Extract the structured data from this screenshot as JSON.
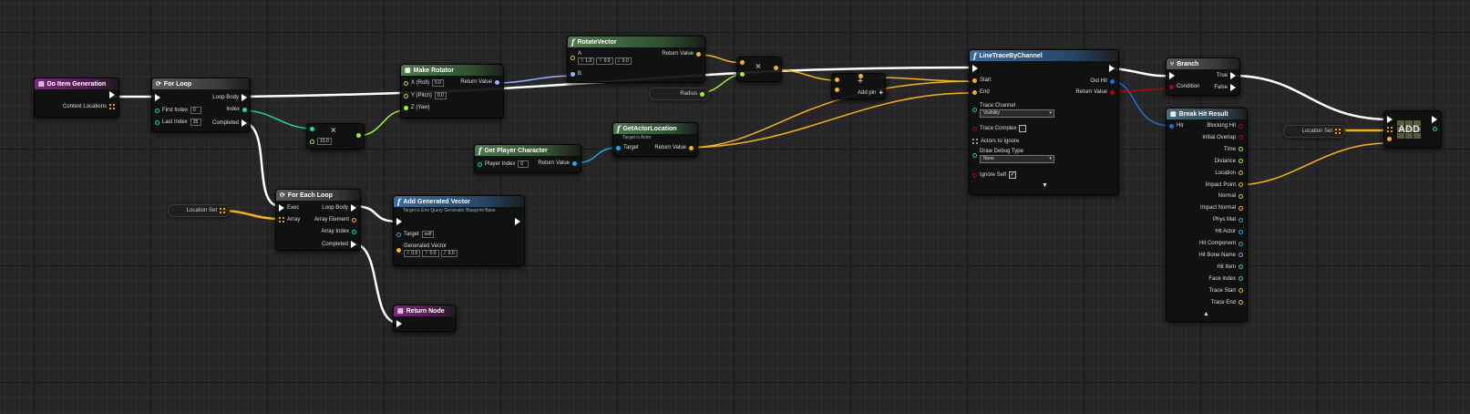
{
  "nodes": {
    "do_item_generation": {
      "title": "Do Item Generation",
      "contextual_locations": "Context Locations"
    },
    "for_loop": {
      "title": "For Loop",
      "first_index_label": "First Index",
      "first_index_value": "0",
      "last_index_label": "Last Index",
      "last_index_value": "35",
      "loop_body": "Loop Body",
      "index": "Index",
      "completed": "Completed"
    },
    "multiply": {
      "op": "×",
      "value": "10.0"
    },
    "make_rotator": {
      "title": "Make Rotator",
      "x_label": "X (Roll)",
      "x_value": "0.0",
      "y_label": "Y (Pitch)",
      "y_value": "0.0",
      "z_label": "Z (Yaw)",
      "return_value": "Return Value"
    },
    "rotate_vector": {
      "title": "RotateVector",
      "a_label": "A",
      "x": "1.0",
      "y": "0.0",
      "z": "0.0",
      "b_label": "B",
      "return_value": "Return Value"
    },
    "multiply2": {
      "op": "×"
    },
    "radius": {
      "label": "Radius"
    },
    "add_pin": {
      "op": "+",
      "label": "Add pin",
      "plus": "+"
    },
    "get_player_character": {
      "title": "Get Player Character",
      "player_index_label": "Player Index",
      "player_index_value": "0",
      "return_value": "Return Value"
    },
    "get_actor_location": {
      "title": "GetActorLocation",
      "subtitle": "Target is Actor",
      "target": "Target",
      "return_value": "Return Value"
    },
    "line_trace": {
      "title": "LineTraceByChannel",
      "start": "Start",
      "end": "End",
      "trace_channel_label": "Trace Channel",
      "trace_channel_value": "Visibility",
      "trace_complex": "Trace Complex",
      "actors_to_ignore": "Actors to Ignore",
      "draw_debug_label": "Draw Debug Type",
      "draw_debug_value": "None",
      "ignore_self": "Ignore Self",
      "out_hit": "Out Hit",
      "return_value": "Return Value",
      "expand": "▼"
    },
    "branch": {
      "title": "Branch",
      "condition": "Condition",
      "true_label": "True",
      "false_label": "False"
    },
    "break_hit": {
      "title": "Break Hit Result",
      "hit": "Hit",
      "collapse": "▲",
      "outputs": [
        "Blocking Hit",
        "Initial Overlap",
        "Time",
        "Distance",
        "Location",
        "Impact Point",
        "Normal",
        "Impact Normal",
        "Phys Mat",
        "Hit Actor",
        "Hit Component",
        "Hit Bone Name",
        "Hit Item",
        "Face Index",
        "Trace Start",
        "Trace End"
      ]
    },
    "add_array": {
      "label": "ADD"
    },
    "location_set_right": {
      "label": "Location Set"
    },
    "location_set_left": {
      "label": "Location Set"
    },
    "for_each": {
      "title": "For Each Loop",
      "exec": "Exec",
      "array": "Array",
      "loop_body": "Loop Body",
      "array_element": "Array Element",
      "array_index": "Array Index",
      "completed": "Completed"
    },
    "add_generated_vector": {
      "title": "Add Generated Vector",
      "subtitle": "Target is Env Query Generator Blueprint Base",
      "target_label": "Target",
      "target_value": "self",
      "gen_label": "Generated Vector",
      "x": "0.0",
      "y": "0.0",
      "z": "0.0"
    },
    "return_node": {
      "title": "Return Node"
    }
  },
  "colors": {
    "exec": "#ffffff",
    "vector": "#f2b31f",
    "float": "#9ef23a",
    "integer": "#22d6a0",
    "rotator": "#9fb0ff",
    "object": "#1ea9f0",
    "struct": "#1f6fd8",
    "bool": "#b8000f",
    "teal": "#1ec7b0"
  }
}
